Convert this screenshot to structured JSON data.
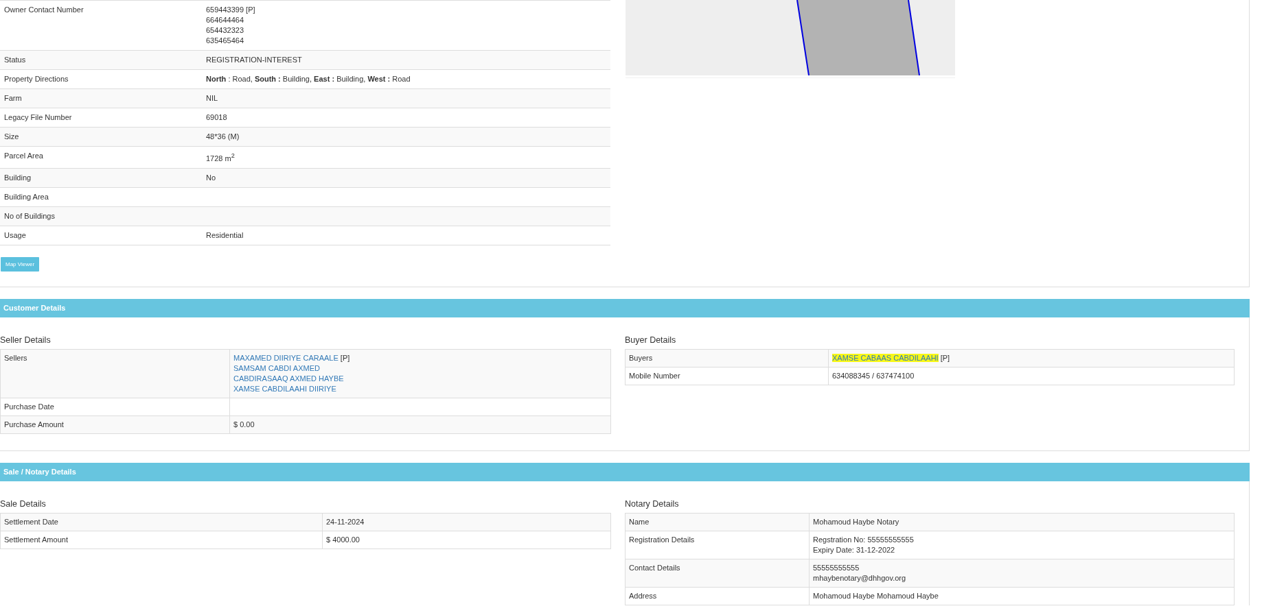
{
  "property": {
    "rows": [
      {
        "label": "Owner Contact Number",
        "lines": [
          {
            "kind": "text",
            "text": "659443399 [P]"
          },
          {
            "kind": "text",
            "text": "664644464"
          },
          {
            "kind": "text",
            "text": "654432323"
          },
          {
            "kind": "text",
            "text": "635465464"
          }
        ]
      },
      {
        "label": "Status",
        "lines": [
          {
            "kind": "text",
            "text": "REGISTRATION-INTEREST"
          }
        ]
      },
      {
        "label": "Property Directions",
        "lines": [
          {
            "kind": "text",
            "text": "**North** : Road, **South :** Building, **East :** Building, **West :** Road"
          }
        ]
      },
      {
        "label": "Farm",
        "lines": [
          {
            "kind": "text",
            "text": "NIL"
          }
        ]
      },
      {
        "label": "Legacy File Number",
        "lines": [
          {
            "kind": "text",
            "text": "69018"
          }
        ]
      },
      {
        "label": "Size",
        "lines": [
          {
            "kind": "text",
            "text": "48*36 (M)"
          }
        ]
      },
      {
        "label": "Parcel Area",
        "lines": [
          {
            "kind": "text",
            "text": "1728 m$^{2}$"
          }
        ]
      },
      {
        "label": "Building",
        "lines": [
          {
            "kind": "text",
            "text": "No"
          }
        ]
      },
      {
        "label": "Building Area",
        "lines": []
      },
      {
        "label": "No of Buildings",
        "lines": []
      },
      {
        "label": "Usage",
        "lines": [
          {
            "kind": "text",
            "text": "Residential"
          }
        ]
      }
    ],
    "button": "Map Viewer"
  },
  "customer": {
    "title": "Customer Details",
    "seller": {
      "heading": "Seller Details",
      "rows": [
        {
          "label": "Sellers",
          "lines": [
            {
              "kind": "link",
              "text": "MAXAMED DIIRIYE CARAALE",
              "note": "[P]"
            },
            {
              "kind": "link",
              "text": "SAMSAM CABDI AXMED"
            },
            {
              "kind": "link",
              "text": "CABDIRASAAQ AXMED HAYBE"
            },
            {
              "kind": "link",
              "text": "XAMSE CABDILAAHI DIIRIYE"
            }
          ]
        },
        {
          "label": "Purchase Date",
          "lines": []
        },
        {
          "label": "Purchase Amount",
          "lines": [
            {
              "kind": "text",
              "text": "$ 0.00"
            }
          ]
        }
      ]
    },
    "buyer": {
      "heading": "Buyer Details",
      "rows": [
        {
          "label": "Buyers",
          "lines": [
            {
              "kind": "link",
              "text": "XAMSE CABAAS CABDILAAHI",
              "note": "[P]",
              "highlighted": true
            }
          ]
        },
        {
          "label": "Mobile Number",
          "lines": [
            {
              "kind": "text",
              "text": "634088345 / 637474100"
            }
          ]
        }
      ]
    }
  },
  "sale": {
    "title": "Sale / Notary Details",
    "sale": {
      "heading": "Sale Details",
      "rows": [
        {
          "label": "Settlement Date",
          "lines": [
            {
              "kind": "text",
              "text": "24-11-2024"
            }
          ]
        },
        {
          "label": "Settlement Amount",
          "lines": [
            {
              "kind": "text",
              "text": "$ 4000.00"
            }
          ]
        }
      ]
    },
    "notary": {
      "heading": "Notary Details",
      "rows": [
        {
          "label": "Name",
          "lines": [
            {
              "kind": "text",
              "text": "Mohamoud Haybe Notary"
            }
          ]
        },
        {
          "label": "Registration Details",
          "lines": [
            {
              "kind": "text",
              "text": "Regstration No: 55555555555"
            },
            {
              "kind": "text",
              "text": "Expiry Date: 31-12-2022"
            }
          ]
        },
        {
          "label": "Contact Details",
          "lines": [
            {
              "kind": "text",
              "text": "55555555555"
            },
            {
              "kind": "text",
              "text": "mhaybenotary@dhhgov.org"
            }
          ]
        },
        {
          "label": "Address",
          "lines": [
            {
              "kind": "text",
              "text": "Mohamoud Haybe Mohamoud Haybe"
            }
          ]
        }
      ]
    }
  }
}
